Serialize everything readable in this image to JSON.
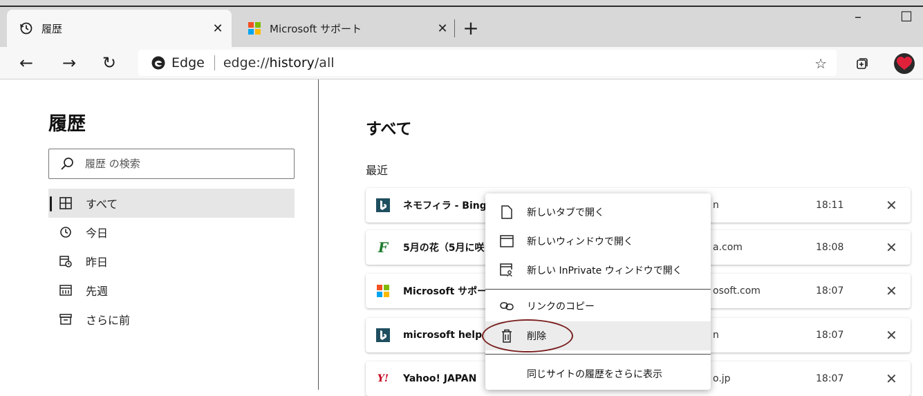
{
  "tabs": [
    {
      "label": "履歴",
      "icon": "history-icon",
      "active": true
    },
    {
      "label": "Microsoft サポート",
      "icon": "microsoft-logo-icon",
      "active": false
    }
  ],
  "window": {
    "minimize": "–",
    "maximize": "☐"
  },
  "toolbar": {
    "back": "←",
    "forward": "→",
    "refresh": "↻",
    "site_name": "Edge",
    "url_prefix": "edge://",
    "url_host": "history",
    "url_path": "/all"
  },
  "sidebar": {
    "title": "履歴",
    "search_placeholder": "履歴 の検索",
    "items": [
      {
        "label": "すべて",
        "icon": "grid-icon",
        "selected": true
      },
      {
        "label": "今日",
        "icon": "clock-icon",
        "selected": false
      },
      {
        "label": "昨日",
        "icon": "calendar-clock-icon",
        "selected": false
      },
      {
        "label": "先週",
        "icon": "calendar-icon",
        "selected": false
      },
      {
        "label": "さらに前",
        "icon": "archive-icon",
        "selected": false
      }
    ]
  },
  "main": {
    "title": "すべて",
    "group_label": "最近",
    "rows": [
      {
        "title": "ネモフィラ - Bing",
        "domain": "n",
        "time": "18:11",
        "icon": "bing-icon"
      },
      {
        "title": "5月の花（5月に咲",
        "domain": "a.com",
        "time": "18:08",
        "icon": "flower-site-icon"
      },
      {
        "title": "Microsoft サポート",
        "domain": "osoft.com",
        "time": "18:07",
        "icon": "microsoft-logo-icon"
      },
      {
        "title": "microsoft help -",
        "domain": "n",
        "time": "18:07",
        "icon": "bing-icon"
      },
      {
        "title": "Yahoo! JAPAN",
        "domain": "o.jp",
        "time": "18:07",
        "icon": "yahoo-icon"
      }
    ]
  },
  "context_menu": {
    "items": [
      {
        "label": "新しいタブで開く",
        "icon": "new-tab-icon"
      },
      {
        "label": "新しいウィンドウで開く",
        "icon": "new-window-icon"
      },
      {
        "label": "新しい InPrivate ウィンドウで開く",
        "icon": "inprivate-window-icon"
      },
      {
        "label": "リンクのコピー",
        "icon": "link-icon"
      },
      {
        "label": "削除",
        "icon": "trash-icon"
      },
      {
        "label": "同じサイトの履歴をさらに表示",
        "icon": ""
      }
    ]
  },
  "colors": {
    "accent": "#0078d4",
    "highlight_ring": "#7a1f1f"
  }
}
